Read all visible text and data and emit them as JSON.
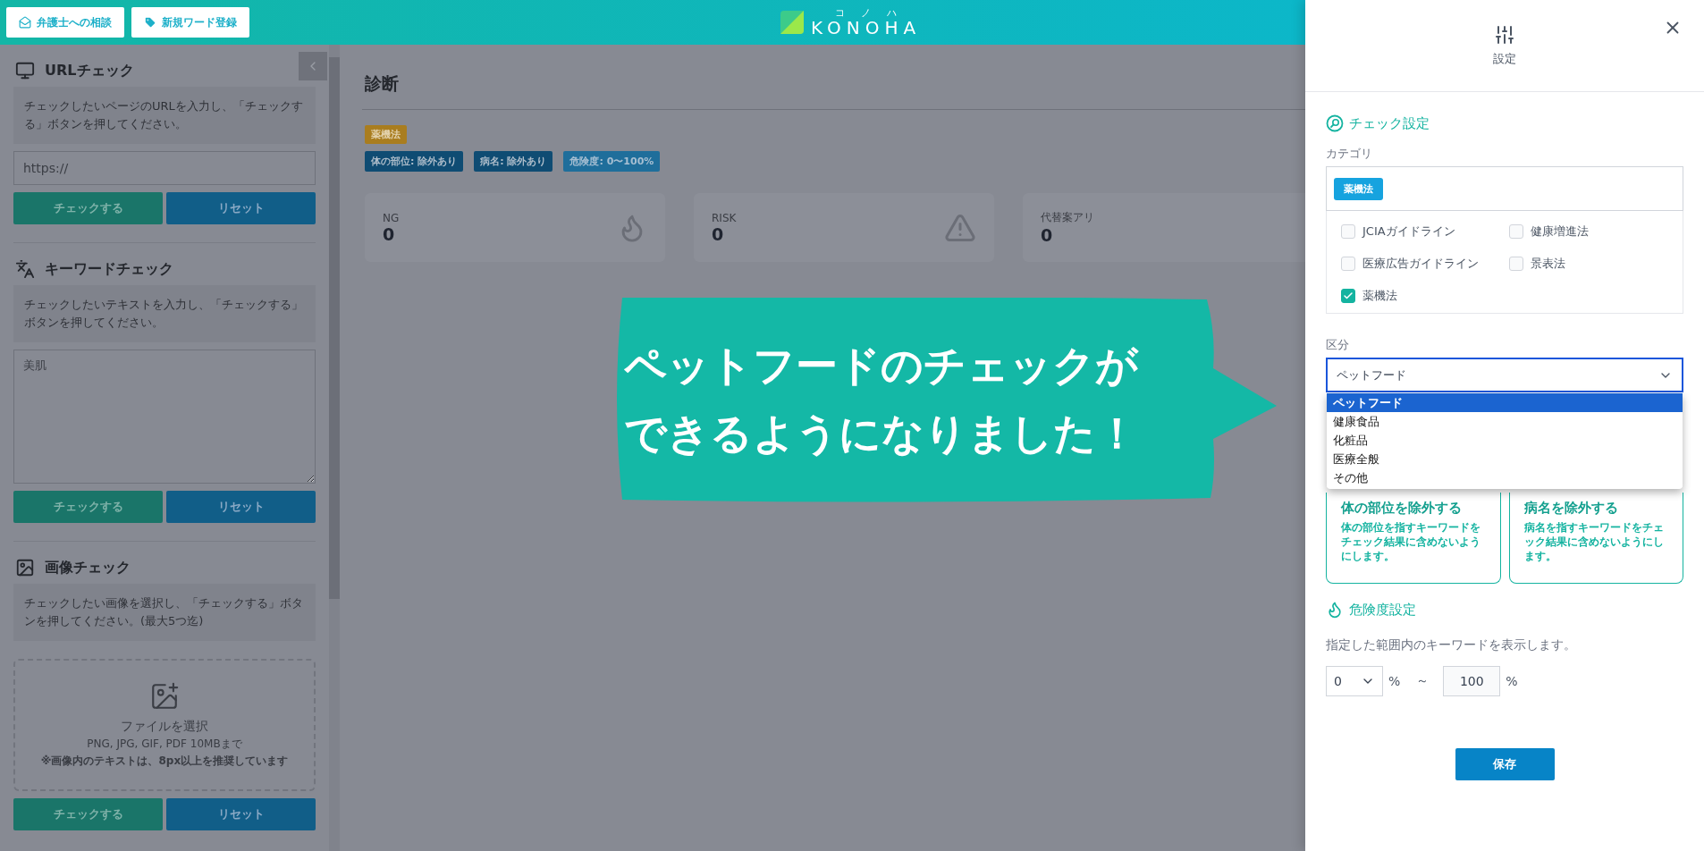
{
  "header": {
    "buttons": [
      {
        "label": "弁護士への相談",
        "kind": "consult"
      },
      {
        "label": "新規ワード登録",
        "kind": "register"
      }
    ],
    "logo": {
      "text": "KONOHA",
      "ruby": [
        "コ",
        "ノ",
        "ハ"
      ]
    }
  },
  "sidebar": {
    "sections": [
      {
        "kind": "url",
        "title": "URLチェック",
        "description": "チェックしたいページのURLを入力し、「チェックする」ボタンを押してください。",
        "placeholder": "https://",
        "buttons": [
          "チェックする",
          "リセット"
        ]
      },
      {
        "kind": "keyword",
        "title": "キーワードチェック",
        "description": "チェックしたいテキストを入力し、「チェックする」ボタンを押してください。",
        "value": "美肌",
        "buttons": [
          "チェックする",
          "リセット"
        ]
      },
      {
        "kind": "image",
        "title": "画像チェック",
        "description": "チェックしたい画像を選択し、「チェックする」ボタンを押してください。(最大5つ迄)",
        "dropzone": {
          "label": "ファイルを選択",
          "formats": "PNG, JPG, GIF, PDF 10MBまで",
          "note": "※画像内のテキストは、8px以上を推奨しています"
        },
        "buttons": [
          "チェックする",
          "リセット"
        ]
      }
    ]
  },
  "main": {
    "title": "診断",
    "category_tags": [
      "薬機法"
    ],
    "filter_tags": [
      {
        "label": "体の部位: 除外あり",
        "kind": "exclusion"
      },
      {
        "label": "病名: 除外あり",
        "kind": "exclusion"
      },
      {
        "label": "危険度: 0〜100%",
        "kind": "risk"
      }
    ],
    "stats": [
      {
        "label": "NG",
        "value": "0",
        "kind": "ng"
      },
      {
        "label": "RISK",
        "value": "0",
        "kind": "risk"
      },
      {
        "label": "代替案アリ",
        "value": "0",
        "kind": "alternative"
      }
    ]
  },
  "callout": {
    "lines": [
      "ペットフードのチェックが",
      "できるようになりました！"
    ]
  },
  "settings": {
    "title": "設定",
    "check_heading": "チェック設定",
    "category_label": "カテゴリ",
    "selected_tags": [
      "薬機法"
    ],
    "options": [
      {
        "label": "JCIAガイドライン",
        "checked": false
      },
      {
        "label": "健康増進法",
        "checked": false
      },
      {
        "label": "医療広告ガイドライン",
        "checked": false
      },
      {
        "label": "景表法",
        "checked": false
      },
      {
        "label": "薬機法",
        "checked": true
      }
    ],
    "division_label": "区分",
    "division_value": "ペットフード",
    "division_options": [
      {
        "label": "ペットフード",
        "selected": true
      },
      {
        "label": "健康食品",
        "selected": false
      },
      {
        "label": "化粧品",
        "selected": false
      },
      {
        "label": "医療全般",
        "selected": false
      },
      {
        "label": "その他",
        "selected": false
      }
    ],
    "exclusion_cards": [
      {
        "title": "体の部位を除外する",
        "description": "体の部位を指すキーワードをチェック結果に含めないようにします。"
      },
      {
        "title": "病名を除外する",
        "description": "病名を指すキーワードをチェック結果に含めないようにします。"
      }
    ],
    "risk_heading": "危険度設定",
    "risk_description": "指定した範囲内のキーワードを表示します。",
    "min": "0",
    "min_unit": "%",
    "separator": "～",
    "max": "100",
    "max_unit": "%",
    "save_button": "保存"
  }
}
